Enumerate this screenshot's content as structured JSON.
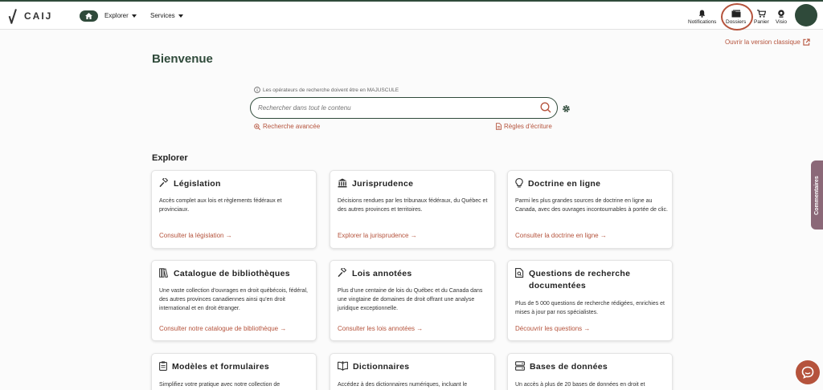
{
  "header": {
    "logo_text": "CAIJ",
    "nav": [
      {
        "label": "Explorer"
      },
      {
        "label": "Services"
      }
    ],
    "icons": {
      "notifications": "Notifications",
      "dossiers": "Dossiers",
      "panier": "Panier",
      "visio": "Visio"
    }
  },
  "classic_link": "Ouvrir la version classique",
  "page_title": "Bienvenue",
  "search": {
    "hint": "Les opérateurs de recherche doivent être en MAJUSCULE",
    "placeholder": "Rechercher dans tout le contenu",
    "advanced": "Recherche avancée",
    "rules": "Règles d'écriture"
  },
  "explore": {
    "title": "Explorer",
    "cards": [
      {
        "title": "Législation",
        "desc": "Accès complet aux lois et règlements fédéraux et provinciaux.",
        "link": "Consulter la législation →"
      },
      {
        "title": "Jurisprudence",
        "desc": "Décisions rendues par les tribunaux fédéraux, du Québec et des autres provinces et territoires.",
        "link": "Explorer la jurisprudence →"
      },
      {
        "title": "Doctrine en ligne",
        "desc": "Parmi les plus grandes sources de doctrine en ligne au Canada, avec des ouvrages incontournables à portée de clic.",
        "link": "Consulter la doctrine en ligne →"
      },
      {
        "title": "Catalogue de bibliothèques",
        "desc": "Une vaste collection d'ouvrages en droit québécois, fédéral, des autres provinces canadiennes ainsi qu'en droit international et en droit étranger.",
        "link": "Consulter notre catalogue de bibliothèque →"
      },
      {
        "title": "Lois annotées",
        "desc": "Plus d'une centaine de lois du Québec et du Canada dans une vingtaine de domaines de droit offrant une analyse juridique exceptionnelle.",
        "link": "Consulter les lois annotées →"
      },
      {
        "title": "Questions de recherche documentées",
        "desc": "Plus de 5 000 questions de recherche rédigées, enrichies et mises à jour par nos spécialistes.",
        "link": "Découvrir les questions →"
      },
      {
        "title": "Modèles et formulaires",
        "desc": "Simplifiez votre pratique avec notre collection de",
        "link": ""
      },
      {
        "title": "Dictionnaires",
        "desc": "Accédez à des dictionnaires numériques, incluant le",
        "link": ""
      },
      {
        "title": "Bases de données",
        "desc": "Un accès à plus de 20 bases de données en droit et",
        "link": ""
      }
    ]
  },
  "side_tab": "Commentaires",
  "colors": {
    "brand": "#2f4a3a",
    "accent": "#b5533c"
  }
}
